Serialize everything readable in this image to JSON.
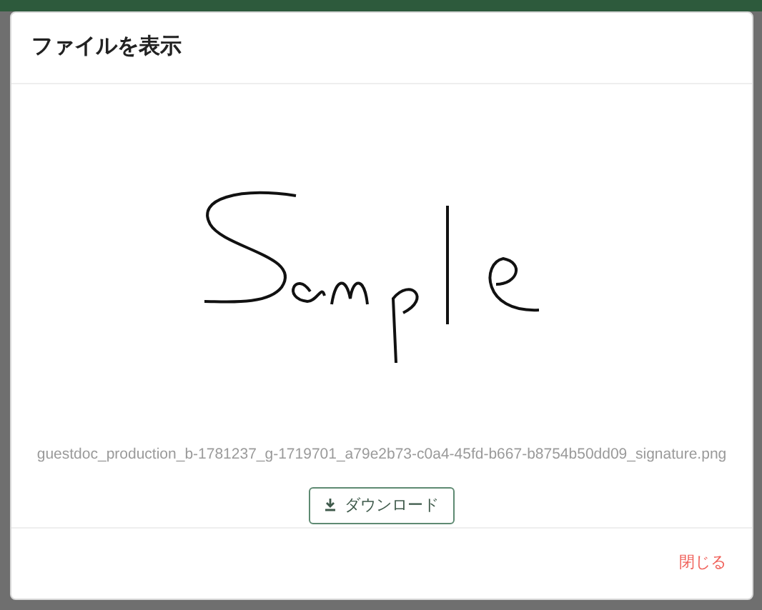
{
  "dialog": {
    "title": "ファイルを表示",
    "file_name": "guestdoc_production_b-1781237_g-1719701_a79e2b73-c0a4-45fd-b667-b8754b50dd09_signature.png",
    "download_button": "ダウンロード",
    "close_button": "閉じる"
  }
}
